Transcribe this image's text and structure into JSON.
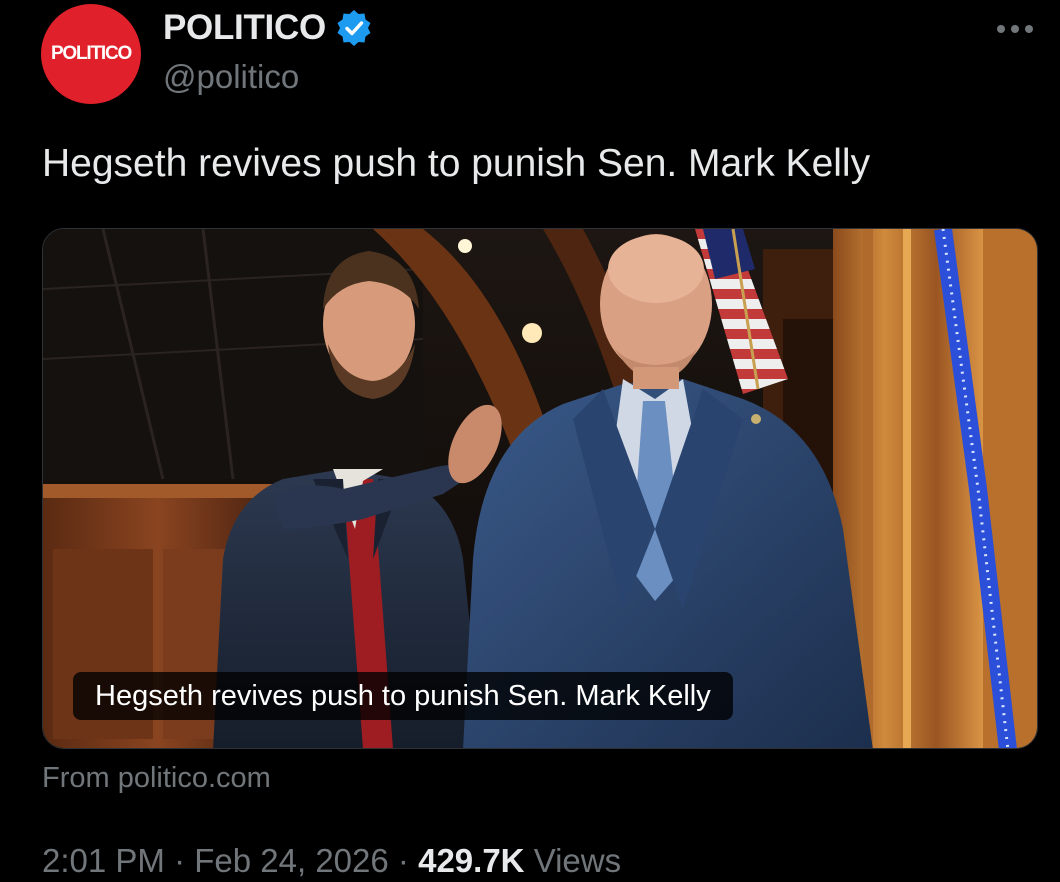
{
  "author": {
    "avatar_text": "POLITICO",
    "display_name": "POLITICO",
    "handle": "@politico",
    "verified": true,
    "avatar_color": "#e0202a",
    "verified_color": "#1d9bf0"
  },
  "menu": {
    "icon": "more-horizontal-icon"
  },
  "tweet": {
    "text": "Hegseth revives push to punish Sen. Mark Kelly"
  },
  "card": {
    "caption": "Hegseth revives push to punish Sen. Mark Kelly",
    "source": "From politico.com"
  },
  "meta": {
    "time": "2:01 PM",
    "separator": "·",
    "date": "Feb 24, 2026",
    "views_count": "429.7K",
    "views_label": "Views"
  },
  "colors": {
    "background": "#000000",
    "primary_text": "#e7e9ea",
    "secondary_text": "#71767b"
  }
}
